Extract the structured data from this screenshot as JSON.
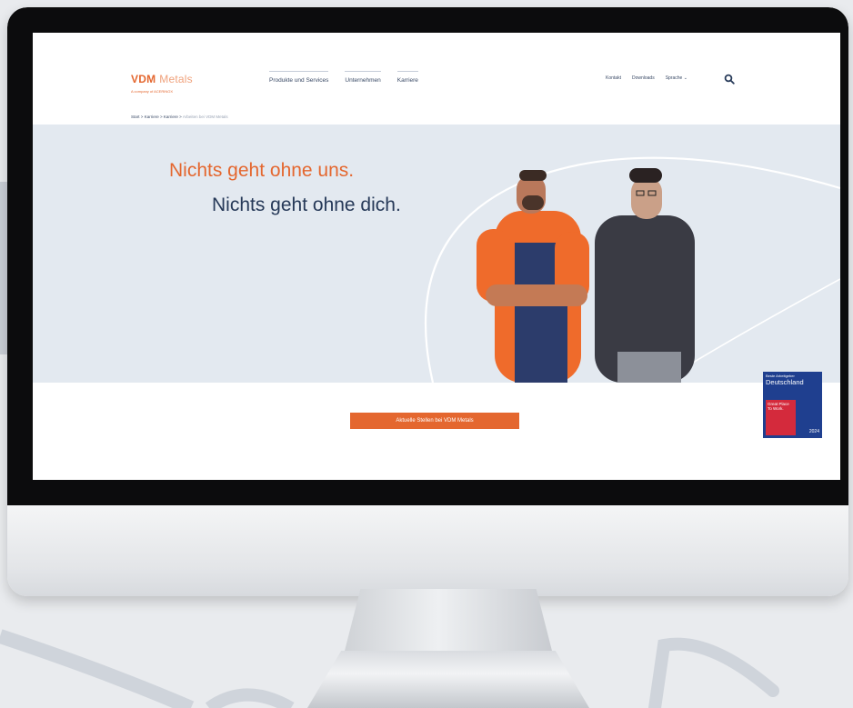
{
  "site": {
    "logo": {
      "brand": "VDM",
      "brand_suffix": "Metals",
      "tagline": "A company of ACERINOX"
    },
    "nav": [
      {
        "label": "Produkte und Services"
      },
      {
        "label": "Unternehmen"
      },
      {
        "label": "Karriere"
      }
    ],
    "utility_nav": [
      {
        "label": "Kontakt"
      },
      {
        "label": "Downloads"
      },
      {
        "label": "Sprache"
      }
    ],
    "breadcrumb": {
      "items": [
        "Start",
        "Karriere",
        "Karriere"
      ],
      "separator": ">",
      "current": "Arbeiten bei VDM Metals"
    },
    "hero": {
      "headline_1": "Nichts geht ohne uns.",
      "headline_2": "Nichts geht ohne dich."
    },
    "award": {
      "top": "Beste Arbeitgeber",
      "country": "Deutschland",
      "badge": "Great Place To Work.",
      "year": "2024"
    },
    "cta": {
      "label": "Aktuelle Stellen bei VDM Metals"
    }
  },
  "colors": {
    "brand_orange": "#e4672f",
    "navy_text": "#263958",
    "hero_bg": "#e3e9f0",
    "award_blue": "#1f3f8f",
    "award_red": "#d42a3c",
    "bezel": "#0c0c0d"
  }
}
